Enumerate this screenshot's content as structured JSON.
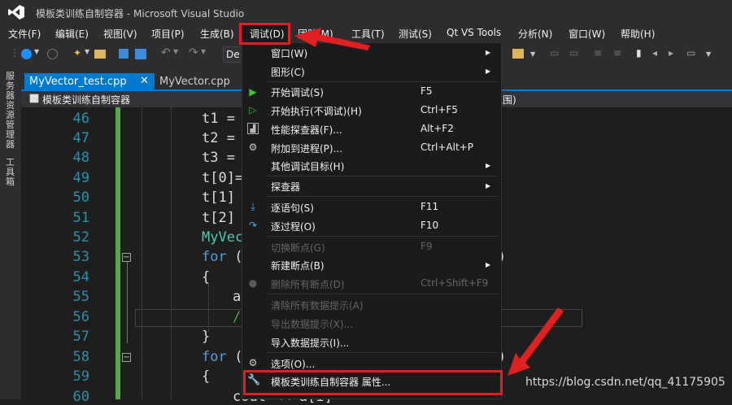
{
  "window": {
    "title": "模板类训练自制容器 - Microsoft Visual Studio"
  },
  "menubar": [
    {
      "label": "文件(F)"
    },
    {
      "label": "编辑(E)"
    },
    {
      "label": "视图(V)"
    },
    {
      "label": "项目(P)"
    },
    {
      "label": "生成(B)"
    },
    {
      "label": "调试(D)"
    },
    {
      "label": "团队(M)"
    },
    {
      "label": "工具(T)"
    },
    {
      "label": "测试(S)"
    },
    {
      "label": "Qt VS Tools"
    },
    {
      "label": "分析(N)"
    },
    {
      "label": "窗口(W)"
    },
    {
      "label": "帮助(H)"
    }
  ],
  "toolbar": {
    "config_value": "De"
  },
  "side_panels": [
    {
      "label": "服务器资源管理器"
    },
    {
      "label": "工具箱"
    }
  ],
  "tabs": [
    {
      "label": "MyVector_test.cpp",
      "active": true
    },
    {
      "label": "MyVector.cpp",
      "active": false
    }
  ],
  "navbar": {
    "project": "模板类训练自制容器",
    "scope": "范围)"
  },
  "editor": {
    "line_numbers": [
      "46",
      "47",
      "48",
      "49",
      "50",
      "51",
      "52",
      "53",
      "54",
      "55",
      "56",
      "57",
      "58",
      "59",
      "60"
    ],
    "code_fragments": {
      "l46": "t1 =",
      "l47": "t2 =",
      "l48": "t3 =",
      "l49": "t[0]=",
      "l50": "t[1]",
      "l51": "t[2]",
      "l52": "MyVec",
      "l53_kw": "for",
      "l53_rest": " (",
      "l53_end": ")",
      "l54": "{",
      "l55": "a",
      "l56": "/",
      "l57": "}",
      "l58_kw": "for",
      "l58_rest": " (",
      "l58_end": ")",
      "l59": "{",
      "l60": "cout << a[i]"
    }
  },
  "debug_menu": {
    "items": [
      {
        "label": "窗口(W)",
        "shortcut": "",
        "submenu": true,
        "disabled": false,
        "icon": ""
      },
      {
        "label": "图形(C)",
        "shortcut": "",
        "submenu": true,
        "disabled": false,
        "icon": ""
      },
      {
        "label": "开始调试(S)",
        "shortcut": "F5",
        "submenu": false,
        "disabled": false,
        "icon": "play-icon"
      },
      {
        "label": "开始执行(不调试)(H)",
        "shortcut": "Ctrl+F5",
        "submenu": false,
        "disabled": false,
        "icon": "play-outline-icon"
      },
      {
        "label": "性能探查器(F)...",
        "shortcut": "Alt+F2",
        "submenu": false,
        "disabled": false,
        "icon": "performance-icon"
      },
      {
        "label": "附加到进程(P)...",
        "shortcut": "Ctrl+Alt+P",
        "submenu": false,
        "disabled": false,
        "icon": "attach-gear-icon"
      },
      {
        "label": "其他调试目标(H)",
        "shortcut": "",
        "submenu": true,
        "disabled": false,
        "icon": ""
      },
      {
        "label": "探查器",
        "shortcut": "",
        "submenu": true,
        "disabled": false,
        "icon": ""
      },
      {
        "label": "逐语句(S)",
        "shortcut": "F11",
        "submenu": false,
        "disabled": false,
        "icon": "step-into-icon"
      },
      {
        "label": "逐过程(O)",
        "shortcut": "F10",
        "submenu": false,
        "disabled": false,
        "icon": "step-over-icon"
      },
      {
        "label": "切换断点(G)",
        "shortcut": "F9",
        "submenu": false,
        "disabled": true,
        "icon": ""
      },
      {
        "label": "新建断点(B)",
        "shortcut": "",
        "submenu": true,
        "disabled": false,
        "icon": ""
      },
      {
        "label": "删除所有断点(D)",
        "shortcut": "Ctrl+Shift+F9",
        "submenu": false,
        "disabled": true,
        "icon": "delete-breakpoints-icon"
      },
      {
        "label": "清除所有数据提示(A)",
        "shortcut": "",
        "submenu": false,
        "disabled": true,
        "icon": ""
      },
      {
        "label": "导出数据提示(X)...",
        "shortcut": "",
        "submenu": false,
        "disabled": true,
        "icon": ""
      },
      {
        "label": "导入数据提示(I)...",
        "shortcut": "",
        "submenu": false,
        "disabled": false,
        "icon": ""
      },
      {
        "label": "选项(O)...",
        "shortcut": "",
        "submenu": false,
        "disabled": false,
        "icon": "gear-icon"
      },
      {
        "label": "模板类训练自制容器 属性...",
        "shortcut": "",
        "submenu": false,
        "disabled": false,
        "icon": "wrench-icon"
      }
    ]
  },
  "watermark": "https://blog.csdn.net/qq_41175905",
  "colors": {
    "accent": "#007acc",
    "highlight": "#e02020",
    "change_bar": "#57a64a"
  }
}
